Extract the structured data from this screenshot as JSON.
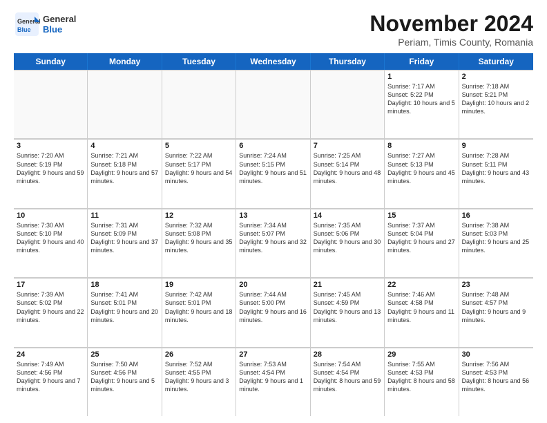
{
  "header": {
    "logo_general": "General",
    "logo_blue": "Blue",
    "month_title": "November 2024",
    "location": "Periam, Timis County, Romania"
  },
  "days_of_week": [
    "Sunday",
    "Monday",
    "Tuesday",
    "Wednesday",
    "Thursday",
    "Friday",
    "Saturday"
  ],
  "rows": [
    [
      {
        "day": "",
        "info": "",
        "empty": true
      },
      {
        "day": "",
        "info": "",
        "empty": true
      },
      {
        "day": "",
        "info": "",
        "empty": true
      },
      {
        "day": "",
        "info": "",
        "empty": true
      },
      {
        "day": "",
        "info": "",
        "empty": true
      },
      {
        "day": "1",
        "info": "Sunrise: 7:17 AM\nSunset: 5:22 PM\nDaylight: 10 hours and 5 minutes.",
        "empty": false
      },
      {
        "day": "2",
        "info": "Sunrise: 7:18 AM\nSunset: 5:21 PM\nDaylight: 10 hours and 2 minutes.",
        "empty": false
      }
    ],
    [
      {
        "day": "3",
        "info": "Sunrise: 7:20 AM\nSunset: 5:19 PM\nDaylight: 9 hours and 59 minutes.",
        "empty": false
      },
      {
        "day": "4",
        "info": "Sunrise: 7:21 AM\nSunset: 5:18 PM\nDaylight: 9 hours and 57 minutes.",
        "empty": false
      },
      {
        "day": "5",
        "info": "Sunrise: 7:22 AM\nSunset: 5:17 PM\nDaylight: 9 hours and 54 minutes.",
        "empty": false
      },
      {
        "day": "6",
        "info": "Sunrise: 7:24 AM\nSunset: 5:15 PM\nDaylight: 9 hours and 51 minutes.",
        "empty": false
      },
      {
        "day": "7",
        "info": "Sunrise: 7:25 AM\nSunset: 5:14 PM\nDaylight: 9 hours and 48 minutes.",
        "empty": false
      },
      {
        "day": "8",
        "info": "Sunrise: 7:27 AM\nSunset: 5:13 PM\nDaylight: 9 hours and 45 minutes.",
        "empty": false
      },
      {
        "day": "9",
        "info": "Sunrise: 7:28 AM\nSunset: 5:11 PM\nDaylight: 9 hours and 43 minutes.",
        "empty": false
      }
    ],
    [
      {
        "day": "10",
        "info": "Sunrise: 7:30 AM\nSunset: 5:10 PM\nDaylight: 9 hours and 40 minutes.",
        "empty": false
      },
      {
        "day": "11",
        "info": "Sunrise: 7:31 AM\nSunset: 5:09 PM\nDaylight: 9 hours and 37 minutes.",
        "empty": false
      },
      {
        "day": "12",
        "info": "Sunrise: 7:32 AM\nSunset: 5:08 PM\nDaylight: 9 hours and 35 minutes.",
        "empty": false
      },
      {
        "day": "13",
        "info": "Sunrise: 7:34 AM\nSunset: 5:07 PM\nDaylight: 9 hours and 32 minutes.",
        "empty": false
      },
      {
        "day": "14",
        "info": "Sunrise: 7:35 AM\nSunset: 5:06 PM\nDaylight: 9 hours and 30 minutes.",
        "empty": false
      },
      {
        "day": "15",
        "info": "Sunrise: 7:37 AM\nSunset: 5:04 PM\nDaylight: 9 hours and 27 minutes.",
        "empty": false
      },
      {
        "day": "16",
        "info": "Sunrise: 7:38 AM\nSunset: 5:03 PM\nDaylight: 9 hours and 25 minutes.",
        "empty": false
      }
    ],
    [
      {
        "day": "17",
        "info": "Sunrise: 7:39 AM\nSunset: 5:02 PM\nDaylight: 9 hours and 22 minutes.",
        "empty": false
      },
      {
        "day": "18",
        "info": "Sunrise: 7:41 AM\nSunset: 5:01 PM\nDaylight: 9 hours and 20 minutes.",
        "empty": false
      },
      {
        "day": "19",
        "info": "Sunrise: 7:42 AM\nSunset: 5:01 PM\nDaylight: 9 hours and 18 minutes.",
        "empty": false
      },
      {
        "day": "20",
        "info": "Sunrise: 7:44 AM\nSunset: 5:00 PM\nDaylight: 9 hours and 16 minutes.",
        "empty": false
      },
      {
        "day": "21",
        "info": "Sunrise: 7:45 AM\nSunset: 4:59 PM\nDaylight: 9 hours and 13 minutes.",
        "empty": false
      },
      {
        "day": "22",
        "info": "Sunrise: 7:46 AM\nSunset: 4:58 PM\nDaylight: 9 hours and 11 minutes.",
        "empty": false
      },
      {
        "day": "23",
        "info": "Sunrise: 7:48 AM\nSunset: 4:57 PM\nDaylight: 9 hours and 9 minutes.",
        "empty": false
      }
    ],
    [
      {
        "day": "24",
        "info": "Sunrise: 7:49 AM\nSunset: 4:56 PM\nDaylight: 9 hours and 7 minutes.",
        "empty": false
      },
      {
        "day": "25",
        "info": "Sunrise: 7:50 AM\nSunset: 4:56 PM\nDaylight: 9 hours and 5 minutes.",
        "empty": false
      },
      {
        "day": "26",
        "info": "Sunrise: 7:52 AM\nSunset: 4:55 PM\nDaylight: 9 hours and 3 minutes.",
        "empty": false
      },
      {
        "day": "27",
        "info": "Sunrise: 7:53 AM\nSunset: 4:54 PM\nDaylight: 9 hours and 1 minute.",
        "empty": false
      },
      {
        "day": "28",
        "info": "Sunrise: 7:54 AM\nSunset: 4:54 PM\nDaylight: 8 hours and 59 minutes.",
        "empty": false
      },
      {
        "day": "29",
        "info": "Sunrise: 7:55 AM\nSunset: 4:53 PM\nDaylight: 8 hours and 58 minutes.",
        "empty": false
      },
      {
        "day": "30",
        "info": "Sunrise: 7:56 AM\nSunset: 4:53 PM\nDaylight: 8 hours and 56 minutes.",
        "empty": false
      }
    ]
  ]
}
